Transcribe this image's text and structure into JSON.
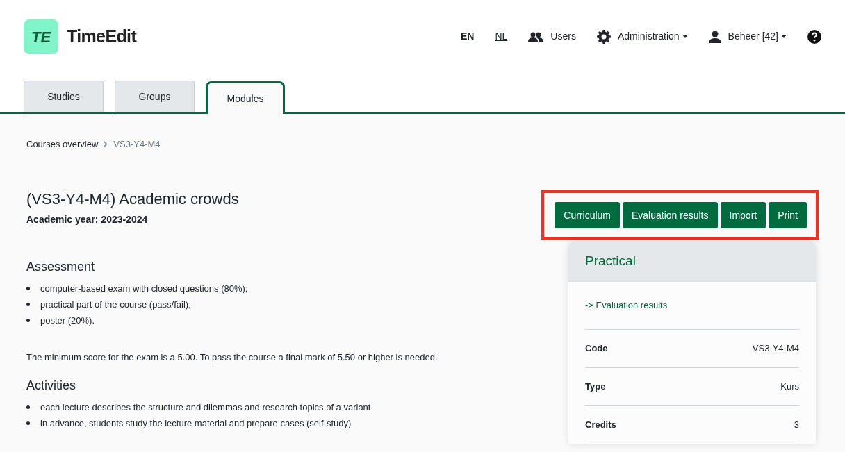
{
  "header": {
    "logo_mark": "TE",
    "logo_text": "TimeEdit",
    "languages": [
      {
        "label": "EN",
        "selected": true
      },
      {
        "label": "NL",
        "selected": false
      }
    ],
    "nav": [
      {
        "kind": "users",
        "label": "Users",
        "dropdown": false
      },
      {
        "kind": "settings",
        "label": "Administration",
        "dropdown": true
      },
      {
        "kind": "user",
        "label": "Beheer [42]",
        "dropdown": true
      },
      {
        "kind": "help"
      }
    ]
  },
  "tabs": [
    {
      "label": "Studies",
      "selected": false
    },
    {
      "label": "Groups",
      "selected": false
    },
    {
      "label": "Modules",
      "selected": true
    }
  ],
  "breadcrumb": [
    "Courses overview",
    "VS3-Y4-M4"
  ],
  "title": "(VS3-Y4-M4) Academic crowds",
  "academic_year": "Academic year: 2023-2024",
  "actions": {
    "highlighted": true,
    "buttons": [
      "Curriculum",
      "Evaluation results",
      "Import",
      "Print"
    ]
  },
  "sections": [
    {
      "heading": "Assessment",
      "items": [
        "computer-based exam with closed questions (80%);",
        "practical part of the course (pass/fail);",
        "poster (20%)."
      ],
      "note": "The minimum score for the exam is a 5.00. To pass the course a final mark of 5.50 or higher is needed."
    },
    {
      "heading": "Activities",
      "items": [
        "each lecture describes the structure and dilemmas and research topics of a variant",
        "in advance, students study the lecture material and prepare cases (self-study)"
      ]
    }
  ],
  "card": {
    "title": "Practical",
    "link": "-> Evaluation results",
    "rows": [
      {
        "label": "Code",
        "value": "VS3-Y4-M4"
      },
      {
        "label": "Type",
        "value": "Kurs"
      },
      {
        "label": "Credits",
        "value": "3"
      }
    ]
  }
}
